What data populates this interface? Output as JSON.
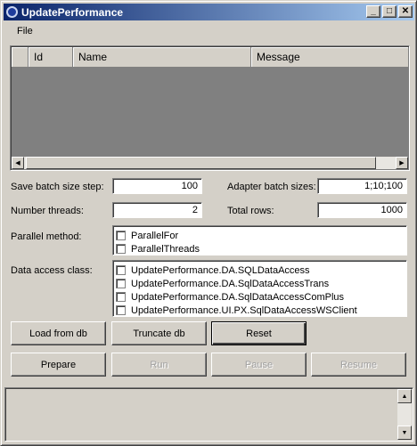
{
  "window": {
    "title": "UpdatePerformance",
    "minimize": "_",
    "maximize": "□",
    "close": "✕"
  },
  "menu": {
    "file": "File"
  },
  "grid": {
    "columns": [
      "",
      "Id",
      "Name",
      "Message"
    ],
    "scroll_left": "◀",
    "scroll_right": "▶"
  },
  "form": {
    "save_batch_label": "Save batch size step:",
    "save_batch_value": "100",
    "adapter_batch_label": "Adapter batch sizes:",
    "adapter_batch_value": "1;10;100",
    "threads_label": "Number threads:",
    "threads_value": "2",
    "total_rows_label": "Total rows:",
    "total_rows_value": "1000",
    "parallel_label": "Parallel method:",
    "parallel_options": [
      "ParallelFor",
      "ParallelThreads"
    ],
    "data_access_label": "Data access class:",
    "data_access_options": [
      "UpdatePerformance.DA.SQLDataAccess",
      "UpdatePerformance.DA.SqlDataAccessTrans",
      "UpdatePerformance.DA.SqlDataAccessComPlus",
      "UpdatePerformance.UI.PX.SqlDataAccessWSClient"
    ]
  },
  "buttons": {
    "load": "Load from db",
    "truncate": "Truncate db",
    "reset": "Reset",
    "prepare": "Prepare",
    "run": "Run",
    "pause": "Pause",
    "resume": "Resume"
  },
  "log": {
    "scroll_up": "▲",
    "scroll_down": "▼"
  }
}
